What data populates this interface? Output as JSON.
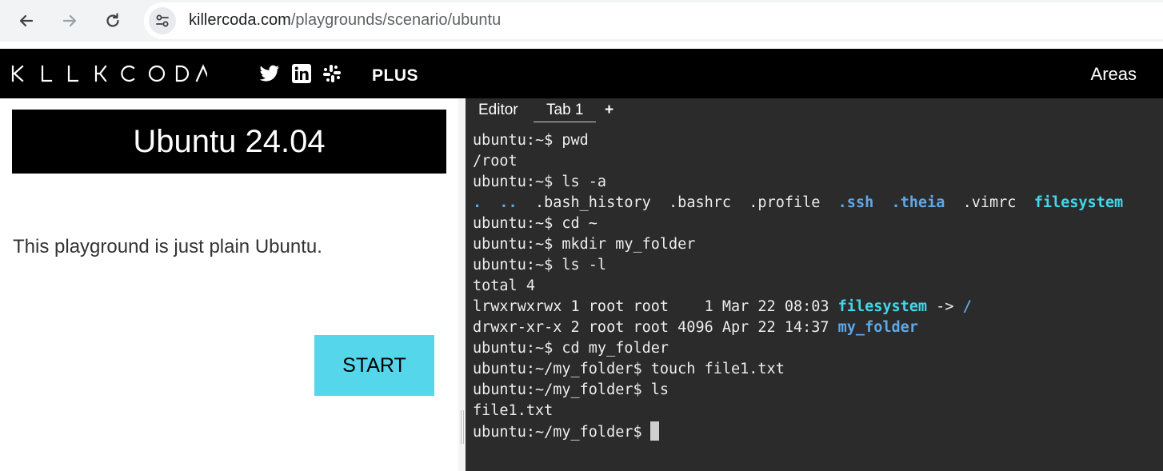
{
  "browser": {
    "url_host": "killercoda.com",
    "url_path": "/playgrounds/scenario/ubuntu"
  },
  "header": {
    "logo_alt": "KILLERCODA",
    "plus_label": "PLUS",
    "areas_label": "Areas",
    "social_icons": [
      "twitter-icon",
      "linkedin-icon",
      "slack-icon"
    ]
  },
  "scenario": {
    "title": "Ubuntu 24.04",
    "description": "This playground is just plain Ubuntu.",
    "start_label": "START",
    "start_color": "#55d6eb"
  },
  "terminal": {
    "tabs": [
      "Editor",
      "Tab 1",
      "+"
    ],
    "lines": [
      [
        {
          "t": "ubuntu:~$ pwd"
        }
      ],
      [
        {
          "t": "/root"
        }
      ],
      [
        {
          "t": "ubuntu:~$ ls -a"
        }
      ],
      [
        {
          "t": ".",
          "c": "blue"
        },
        {
          "t": "  "
        },
        {
          "t": "..",
          "c": "blue"
        },
        {
          "t": "  .bash_history  .bashrc  .profile  "
        },
        {
          "t": ".ssh",
          "c": "blue"
        },
        {
          "t": "  "
        },
        {
          "t": ".theia",
          "c": "blue"
        },
        {
          "t": "  .vimrc  "
        },
        {
          "t": "filesystem",
          "c": "cyan"
        }
      ],
      [
        {
          "t": "ubuntu:~$ cd ~"
        }
      ],
      [
        {
          "t": "ubuntu:~$ mkdir my_folder"
        }
      ],
      [
        {
          "t": "ubuntu:~$ ls -l"
        }
      ],
      [
        {
          "t": "total 4"
        }
      ],
      [
        {
          "t": "lrwxrwxrwx 1 root root    1 Mar 22 08:03 "
        },
        {
          "t": "filesystem",
          "c": "cyan"
        },
        {
          "t": " -> "
        },
        {
          "t": "/",
          "c": "blue"
        }
      ],
      [
        {
          "t": "drwxr-xr-x 2 root root 4096 Apr 22 14:37 "
        },
        {
          "t": "my_folder",
          "c": "blue"
        }
      ],
      [
        {
          "t": "ubuntu:~$ cd my_folder"
        }
      ],
      [
        {
          "t": "ubuntu:~/my_folder$ touch file1.txt"
        }
      ],
      [
        {
          "t": "ubuntu:~/my_folder$ ls"
        }
      ],
      [
        {
          "t": "file1.txt"
        }
      ],
      [
        {
          "t": "ubuntu:~/my_folder$"
        }
      ]
    ],
    "colors": {
      "background": "#2b2b2b",
      "text": "#ececec",
      "dir_blue": "#5fa8e8",
      "link_cyan": "#3fd8e8"
    }
  }
}
